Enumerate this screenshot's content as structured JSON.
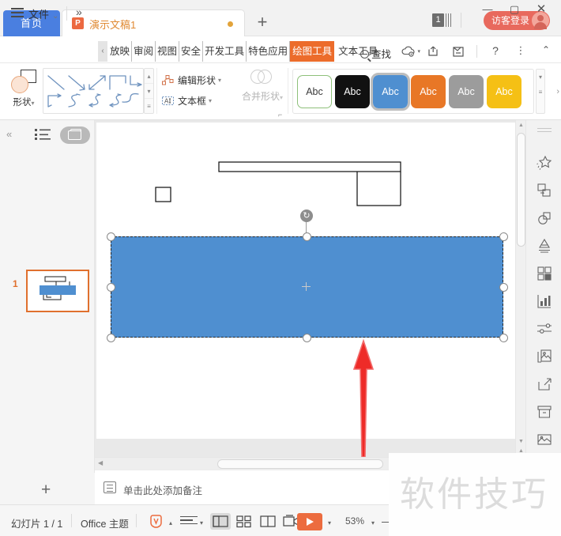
{
  "titlebar": {
    "home_tab": "首页",
    "doc_tab": "演示文稿1",
    "doc_icon_letter": "P",
    "new_tab": "+",
    "minimize": "—",
    "maximize": "▢",
    "close": "✕",
    "notify_count": "1",
    "login_label": "访客登录"
  },
  "menubar": {
    "file": "文件",
    "file_caret": "⌄",
    "more": "»",
    "prev_arrow": "‹",
    "tabs": [
      {
        "label": "放映",
        "active": false
      },
      {
        "label": "审阅",
        "active": false
      },
      {
        "label": "视图",
        "active": false
      },
      {
        "label": "安全",
        "active": false
      },
      {
        "label": "开发工具",
        "active": false
      },
      {
        "label": "特色应用",
        "active": false
      },
      {
        "label": "绘图工具",
        "active": true
      },
      {
        "label": "文本工具",
        "active": false
      }
    ],
    "search": "查找",
    "icons": [
      "cloud-sync-icon",
      "share-icon",
      "collaborate-icon",
      "help-icon",
      "more-options-icon",
      "collapse-ribbon-icon"
    ],
    "help": "?",
    "kebab": "⋮",
    "collapse": "⌃"
  },
  "ribbon": {
    "shapes_label": "形状",
    "caret": "▾",
    "edit_shape": "编辑形状",
    "text_box": "文本框",
    "merge_shapes": "合并形状",
    "dialog_launcher": "⌐",
    "scroll_up": "▴",
    "scroll_down": "▾",
    "scroll_more": "≡",
    "next_arrow": "›",
    "style_label": "Abc",
    "styles": [
      {
        "name": "style-white",
        "bg": "#ffffff",
        "fg": "#3a3a3a",
        "border": "#8ec07a",
        "selected": false
      },
      {
        "name": "style-black",
        "bg": "#111111",
        "fg": "#ffffff",
        "border": "#111111",
        "selected": false
      },
      {
        "name": "style-blue",
        "bg": "#4f8fd0",
        "fg": "#ffffff",
        "border": "#4f8fd0",
        "selected": true
      },
      {
        "name": "style-orange",
        "bg": "#e87726",
        "fg": "#ffffff",
        "border": "#e87726",
        "selected": false
      },
      {
        "name": "style-gray",
        "bg": "#9c9c9c",
        "fg": "#ffffff",
        "border": "#9c9c9c",
        "selected": false
      },
      {
        "name": "style-yellow",
        "bg": "#f5c015",
        "fg": "#ffffff",
        "border": "#f5c015",
        "selected": false
      }
    ]
  },
  "leftpanel": {
    "collapse": "«",
    "outline_view": "outline-view-icon",
    "slides_view": "slides-view-icon",
    "slide_number": "1",
    "add_slide": "+"
  },
  "canvas": {
    "shape_fill": "#4f8fd0",
    "rotate_handle": "rotate-handle-icon",
    "annotation": "red-up-arrow-annotation"
  },
  "notes": {
    "placeholder": "单击此处添加备注"
  },
  "statusbar": {
    "slide_count": "幻灯片 1 / 1",
    "theme": "Office 主题",
    "brand_icon": "wps-brand-icon",
    "caret": "▴",
    "align_icon": "align-icon",
    "align_caret": "▾",
    "views": [
      {
        "name": "view-normal",
        "active": true
      },
      {
        "name": "view-sorter",
        "active": false
      },
      {
        "name": "view-reading",
        "active": false
      },
      {
        "name": "view-presenter",
        "active": false
      }
    ],
    "play_caret": "▾",
    "zoom": "53%",
    "zoom_caret": "▾",
    "zoom_out": "—"
  },
  "watermark": {
    "text": "软件技巧"
  }
}
